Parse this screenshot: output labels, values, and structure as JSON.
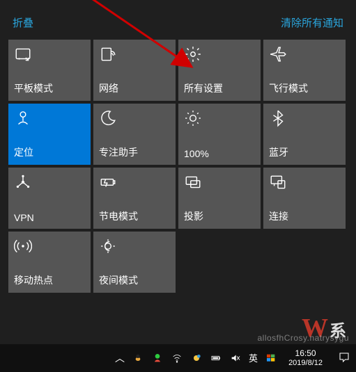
{
  "header": {
    "collapse": "折叠",
    "clear": "清除所有通知"
  },
  "tiles": [
    {
      "icon": "tablet-icon",
      "label": "平板模式"
    },
    {
      "icon": "network-icon",
      "label": "网络"
    },
    {
      "icon": "settings-icon",
      "label": "所有设置"
    },
    {
      "icon": "airplane-icon",
      "label": "飞行模式"
    },
    {
      "icon": "location-icon",
      "label": "定位",
      "active": true
    },
    {
      "icon": "moon-icon",
      "label": "专注助手"
    },
    {
      "icon": "brightness-icon",
      "label": "100%"
    },
    {
      "icon": "bluetooth-icon",
      "label": "蓝牙"
    },
    {
      "icon": "vpn-icon",
      "label": "VPN"
    },
    {
      "icon": "battery-icon",
      "label": "节电模式"
    },
    {
      "icon": "project-icon",
      "label": "投影"
    },
    {
      "icon": "connect-icon",
      "label": "连接"
    },
    {
      "icon": "hotspot-icon",
      "label": "移动热点"
    },
    {
      "icon": "nightlight-icon",
      "label": "夜间模式"
    }
  ],
  "taskbar": {
    "ime": "英",
    "time": "16:50",
    "date": "2019/8/12"
  },
  "watermark": {
    "big_w": "W",
    "big_rest": "系",
    "url": "allosfhCrosy.natrysygu"
  }
}
